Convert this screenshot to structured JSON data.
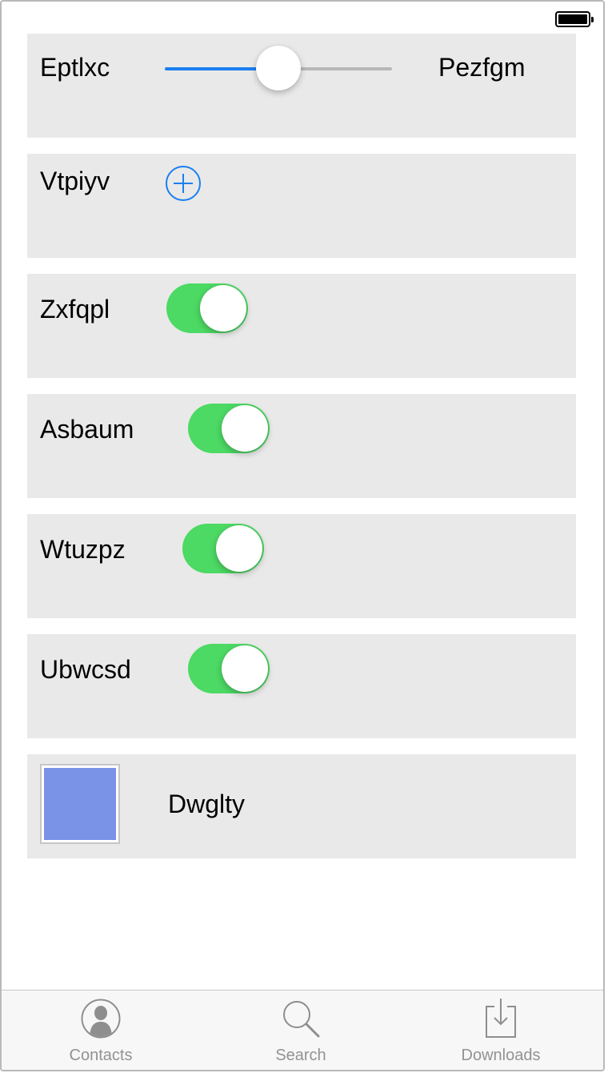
{
  "status_bar": {
    "battery_icon": "battery-full-icon"
  },
  "rows": {
    "slider_row": {
      "label_left": "Eptlxc",
      "label_right": "Pezfgm",
      "slider_value": 0.5
    },
    "add_row": {
      "label": "Vtpiyv",
      "icon": "plus-circle-icon"
    },
    "toggle_rows": [
      {
        "label": "Zxfqpl",
        "on": true
      },
      {
        "label": "Asbaum",
        "on": true
      },
      {
        "label": "Wtuzpz",
        "on": true
      },
      {
        "label": "Ubwcsd",
        "on": true
      }
    ],
    "color_row": {
      "label": "Dwglty",
      "swatch_color": "#7b93e6"
    }
  },
  "tab_bar": {
    "tabs": [
      {
        "label": "Contacts",
        "icon": "contacts-icon"
      },
      {
        "label": "Search",
        "icon": "search-icon"
      },
      {
        "label": "Downloads",
        "icon": "downloads-icon"
      }
    ]
  },
  "colors": {
    "accent": "#1a7ff0",
    "toggle_on": "#4cd964",
    "row_background": "#e9e9e9",
    "tab_inactive": "#929292"
  }
}
